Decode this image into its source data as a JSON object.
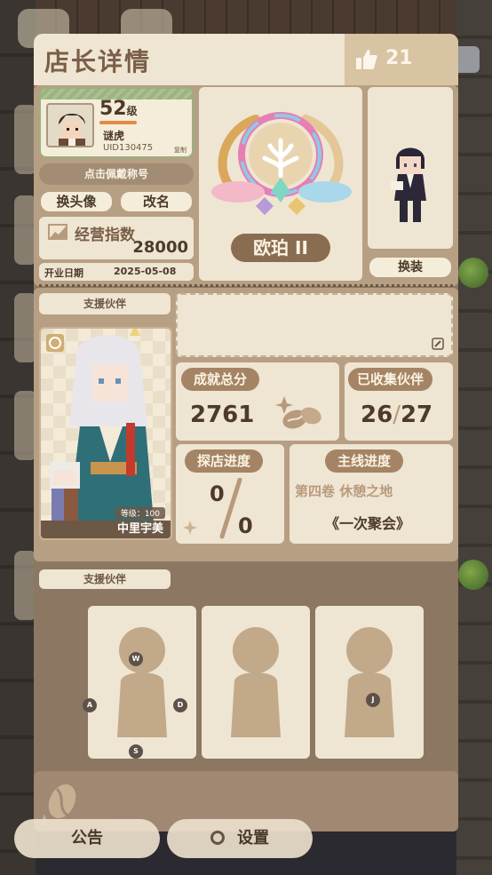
{
  "header": {
    "title": "店长详情",
    "likes": "21"
  },
  "profile": {
    "level": "52",
    "level_unit": "级",
    "name": "谜虎",
    "uid": "UID130475",
    "copy_label": "复制",
    "title_button": "点击佩戴称号",
    "change_avatar": "换头像",
    "rename": "改名"
  },
  "business": {
    "label": "经营指数",
    "value": "28000",
    "open_date_label": "开业日期",
    "open_date": "2025-05-08"
  },
  "rank": {
    "name": "欧珀 II"
  },
  "outfit": {
    "button": "换装"
  },
  "support_main": {
    "label": "支援伙伴",
    "partner_name": "中里宇美",
    "partner_level": "等级：100"
  },
  "stats": {
    "achievement_label": "成就总分",
    "achievement_value": "2761",
    "collected_label": "已收集伙伴",
    "collected_value": "26",
    "collected_total": "27",
    "explore_label": "探店进度",
    "explore_value": "0",
    "explore_total": "0",
    "main_label": "主线进度",
    "main_chapter": "第四卷 休憩之地",
    "main_episode": "《一次聚会》"
  },
  "support_slots": {
    "label": "支援伙伴",
    "keys": [
      "W",
      "A",
      "S",
      "D",
      "J"
    ]
  },
  "bottom": {
    "notice": "公告",
    "settings": "设置"
  },
  "colors": {
    "panel": "#8c7763",
    "card": "#efe5d3",
    "accent": "#a48464"
  }
}
